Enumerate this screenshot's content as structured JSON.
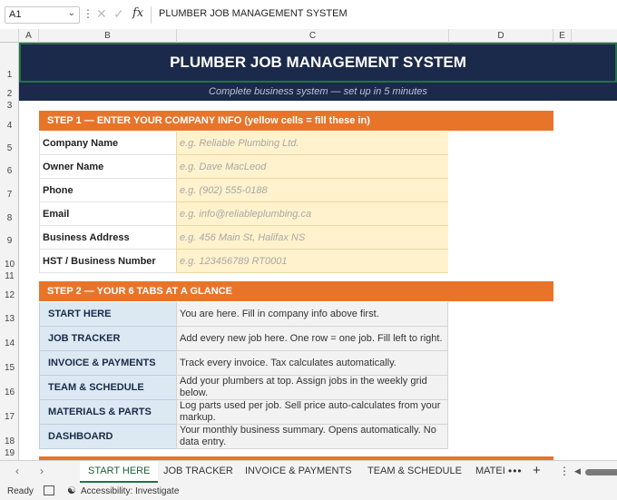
{
  "formula_bar": {
    "name_box": "A1",
    "formula": "PLUMBER JOB MANAGEMENT SYSTEM",
    "fx_label": "fx"
  },
  "columns": [
    "A",
    "B",
    "C",
    "D",
    "E"
  ],
  "rows": [
    "1",
    "2",
    "3",
    "4",
    "5",
    "6",
    "7",
    "8",
    "9",
    "10",
    "11",
    "12",
    "13",
    "14",
    "15",
    "16",
    "17",
    "18",
    "19"
  ],
  "sheet": {
    "title": "PLUMBER JOB MANAGEMENT SYSTEM",
    "subtitle": "Complete business system — set up in 5 minutes",
    "step1_header": "STEP 1 — ENTER YOUR COMPANY INFO  (yellow cells = fill these in)",
    "company_fields": [
      {
        "label": "Company Name",
        "placeholder": "e.g. Reliable Plumbing Ltd."
      },
      {
        "label": "Owner Name",
        "placeholder": "e.g. Dave MacLeod"
      },
      {
        "label": "Phone",
        "placeholder": "e.g. (902) 555-0188"
      },
      {
        "label": "Email",
        "placeholder": "e.g. info@reliableplumbing.ca"
      },
      {
        "label": "Business Address",
        "placeholder": "e.g. 456 Main St, Halifax NS"
      },
      {
        "label": "HST / Business Number",
        "placeholder": "e.g. 123456789 RT0001"
      }
    ],
    "step2_header": "STEP 2 — YOUR 6 TABS AT A GLANCE",
    "tabs_overview": [
      {
        "name": "START HERE",
        "desc": "You are here. Fill in company info above first."
      },
      {
        "name": "JOB TRACKER",
        "desc": "Add every new job here. One row = one job. Fill left to right."
      },
      {
        "name": "INVOICE & PAYMENTS",
        "desc": "Track every invoice. Tax calculates automatically."
      },
      {
        "name": "TEAM & SCHEDULE",
        "desc": "Add your plumbers at top. Assign jobs in the weekly grid below."
      },
      {
        "name": "MATERIALS & PARTS",
        "desc": "Log parts used per job. Sell price auto-calculates from your markup."
      },
      {
        "name": "DASHBOARD",
        "desc": "Your monthly business summary. Opens automatically. No data entry."
      }
    ]
  },
  "sheet_tabs": [
    "START HERE",
    "JOB TRACKER",
    "INVOICE & PAYMENTS",
    "TEAM & SCHEDULE",
    "MATEI"
  ],
  "tabs_more": "•••",
  "status_bar": {
    "ready": "Ready",
    "accessibility": "Accessibility: Investigate"
  },
  "colors": {
    "navy": "#1b2a4a",
    "orange": "#e8742a",
    "yellow_fill": "#fff2cc",
    "blue_fill": "#dce9f3",
    "excel_green": "#217346"
  }
}
